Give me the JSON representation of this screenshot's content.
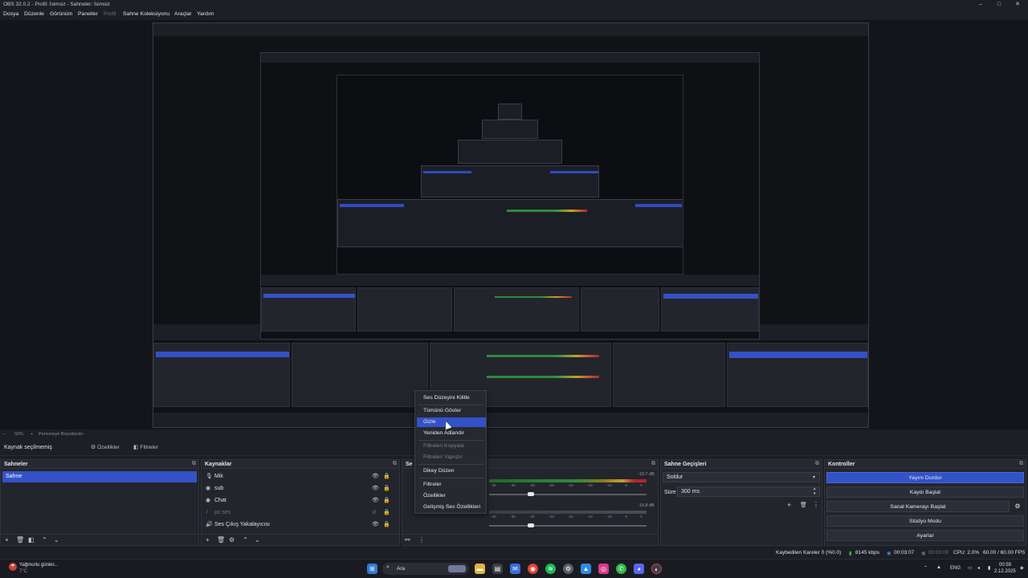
{
  "window": {
    "title": "OBS 32.0.2 - Profil: İsimsiz - Sahneler: İsimsiz",
    "minimize": "–",
    "maximize": "□",
    "close": "✕"
  },
  "menu": {
    "file": "Dosya",
    "edit": "Düzenle",
    "view": "Görünüm",
    "docks": "Paneller",
    "profile": "Profil",
    "scene_collection": "Sahne Koleksiyonu",
    "tools": "Araçlar",
    "help": "Yardım"
  },
  "preview_strip": {
    "zoom": "92%",
    "fit": "Pencereye Boyutlandır"
  },
  "source_toolbar": {
    "no_source": "Kaynak seçilmemiş",
    "properties": "Özellikler",
    "filters": "Filtreler"
  },
  "scenes": {
    "title": "Sahneler",
    "items": [
      "Sahne"
    ]
  },
  "sources": {
    "title": "Kaynaklar",
    "items": [
      {
        "name": "Mik",
        "icon": "mic-icon",
        "glyph": "🎙"
      },
      {
        "name": "sub",
        "icon": "globe-icon",
        "glyph": "◉"
      },
      {
        "name": "Chat",
        "icon": "globe-icon",
        "glyph": "◉"
      },
      {
        "name": "pc ses",
        "icon": "speaker-icon",
        "glyph": "♪"
      },
      {
        "name": "Ses Çıkış Yakalayıcısı",
        "icon": "speaker-icon",
        "glyph": "🔊"
      }
    ]
  },
  "mixer": {
    "title": "Se",
    "rows": [
      {
        "db": "-19.7 dB",
        "ticks": [
          "-40",
          "-35",
          "-30",
          "-25",
          "-20",
          "-15",
          "-10",
          "-5",
          "0"
        ]
      },
      {
        "db": "-19.8 dB",
        "ticks": [
          "-40",
          "-35",
          "-30",
          "-25",
          "-20",
          "-15",
          "-10",
          "-5",
          "0"
        ]
      }
    ]
  },
  "transitions": {
    "title": "Sahne Geçişleri",
    "type": "Soldur",
    "duration_label": "Süre",
    "duration": "300 ms"
  },
  "controls": {
    "title": "Kontroller",
    "stop_stream": "Yayını Durdur",
    "start_recording": "Kaydı Başlat",
    "start_vcam": "Sanal Kamerayı Başlat",
    "studio_mode": "Stüdyo Modu",
    "settings": "Ayarlar"
  },
  "context_menu": {
    "items": [
      {
        "label": "Ses Düzeyini Kilitle",
        "state": "normal"
      },
      {
        "label": "Tümünü Göster",
        "state": "normal"
      },
      {
        "label": "Gizle",
        "state": "selected"
      },
      {
        "label": "Yeniden Adlandır",
        "state": "normal"
      },
      {
        "label": "Filtreleri Kopyala",
        "state": "disabled"
      },
      {
        "label": "Filtreleri Yapıştır",
        "state": "disabled"
      },
      {
        "label": "Dikey Düzen",
        "state": "normal"
      },
      {
        "label": "Filtreler",
        "state": "normal"
      },
      {
        "label": "Özellikler",
        "state": "normal"
      },
      {
        "label": "Gelişmiş Ses Özellikleri",
        "state": "normal"
      }
    ]
  },
  "status": {
    "dropped": "Kaybedilen Kareler 0 (%0.0)",
    "bitrate": "8145 kbps",
    "live_time": "00:03:07",
    "rec_time": "00:00:00",
    "cpu": "CPU: 2.0%",
    "fps": "60.00 / 60.00 FPS"
  },
  "taskbar": {
    "weather": "Yağmurlu günler...",
    "temp": "7°C",
    "search": "Ara",
    "lang": "ENG",
    "time": "00:59",
    "date": "2.12.2025"
  },
  "colors": {
    "accent": "#3452c7",
    "panel": "#23252d",
    "background": "#1d1f26"
  }
}
